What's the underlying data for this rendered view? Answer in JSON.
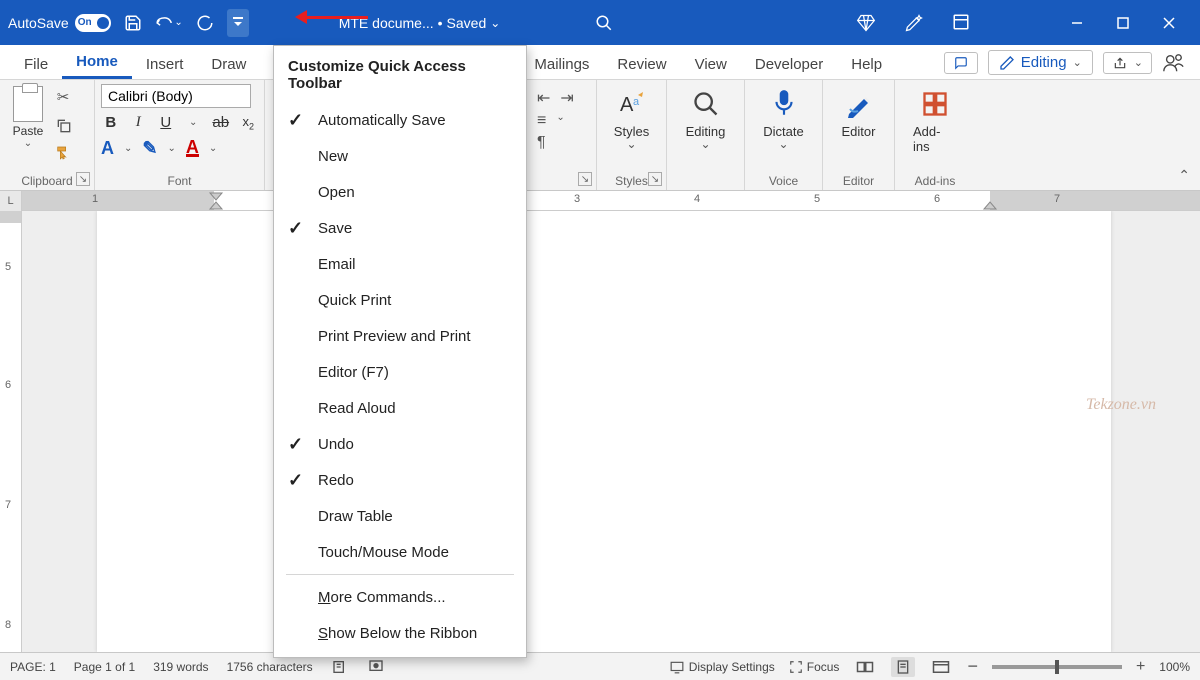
{
  "titlebar": {
    "autosave_label": "AutoSave",
    "autosave_state": "On",
    "doc_name": "MTE docume...",
    "saved_label": "Saved"
  },
  "tabs": {
    "file": "File",
    "home": "Home",
    "insert": "Insert",
    "draw": "Draw",
    "mailings": "Mailings",
    "review": "Review",
    "view": "View",
    "developer": "Developer",
    "help": "Help",
    "editing_mode": "Editing"
  },
  "ribbon": {
    "paste": "Paste",
    "clipboard": "Clipboard",
    "font_name_value": "Calibri (Body)",
    "font_group": "Font",
    "styles": "Styles",
    "styles_group": "Styles",
    "editing": "Editing",
    "dictate": "Dictate",
    "voice": "Voice",
    "editor": "Editor",
    "editor_group": "Editor",
    "addins": "Add-ins",
    "addins_group": "Add-ins"
  },
  "dropdown": {
    "title": "Customize Quick Access Toolbar",
    "items": [
      {
        "label": "Automatically Save",
        "checked": true
      },
      {
        "label": "New",
        "checked": false
      },
      {
        "label": "Open",
        "checked": false
      },
      {
        "label": "Save",
        "checked": true
      },
      {
        "label": "Email",
        "checked": false
      },
      {
        "label": "Quick Print",
        "checked": false
      },
      {
        "label": "Print Preview and Print",
        "checked": false
      },
      {
        "label": "Editor (F7)",
        "checked": false
      },
      {
        "label": "Read Aloud",
        "checked": false
      },
      {
        "label": "Undo",
        "checked": true
      },
      {
        "label": "Redo",
        "checked": true
      },
      {
        "label": "Draw Table",
        "checked": false
      },
      {
        "label": "Touch/Mouse Mode",
        "checked": false
      }
    ],
    "more": "More Commands...",
    "show_below": "Show Below the Ribbon"
  },
  "ruler": {
    "n1": "1",
    "n3": "3",
    "n4": "4",
    "n5": "5",
    "n6": "6",
    "n7": "7"
  },
  "vruler": {
    "n5a": "5",
    "n6": "6",
    "n7": "7",
    "n8": "8"
  },
  "status": {
    "page_label": "PAGE: 1",
    "page_of": "Page 1 of 1",
    "words": "319 words",
    "chars": "1756 characters",
    "display_settings": "Display Settings",
    "focus": "Focus",
    "zoom": "100%"
  },
  "watermark": "Tekzone.vn",
  "ruler_corner": "L"
}
